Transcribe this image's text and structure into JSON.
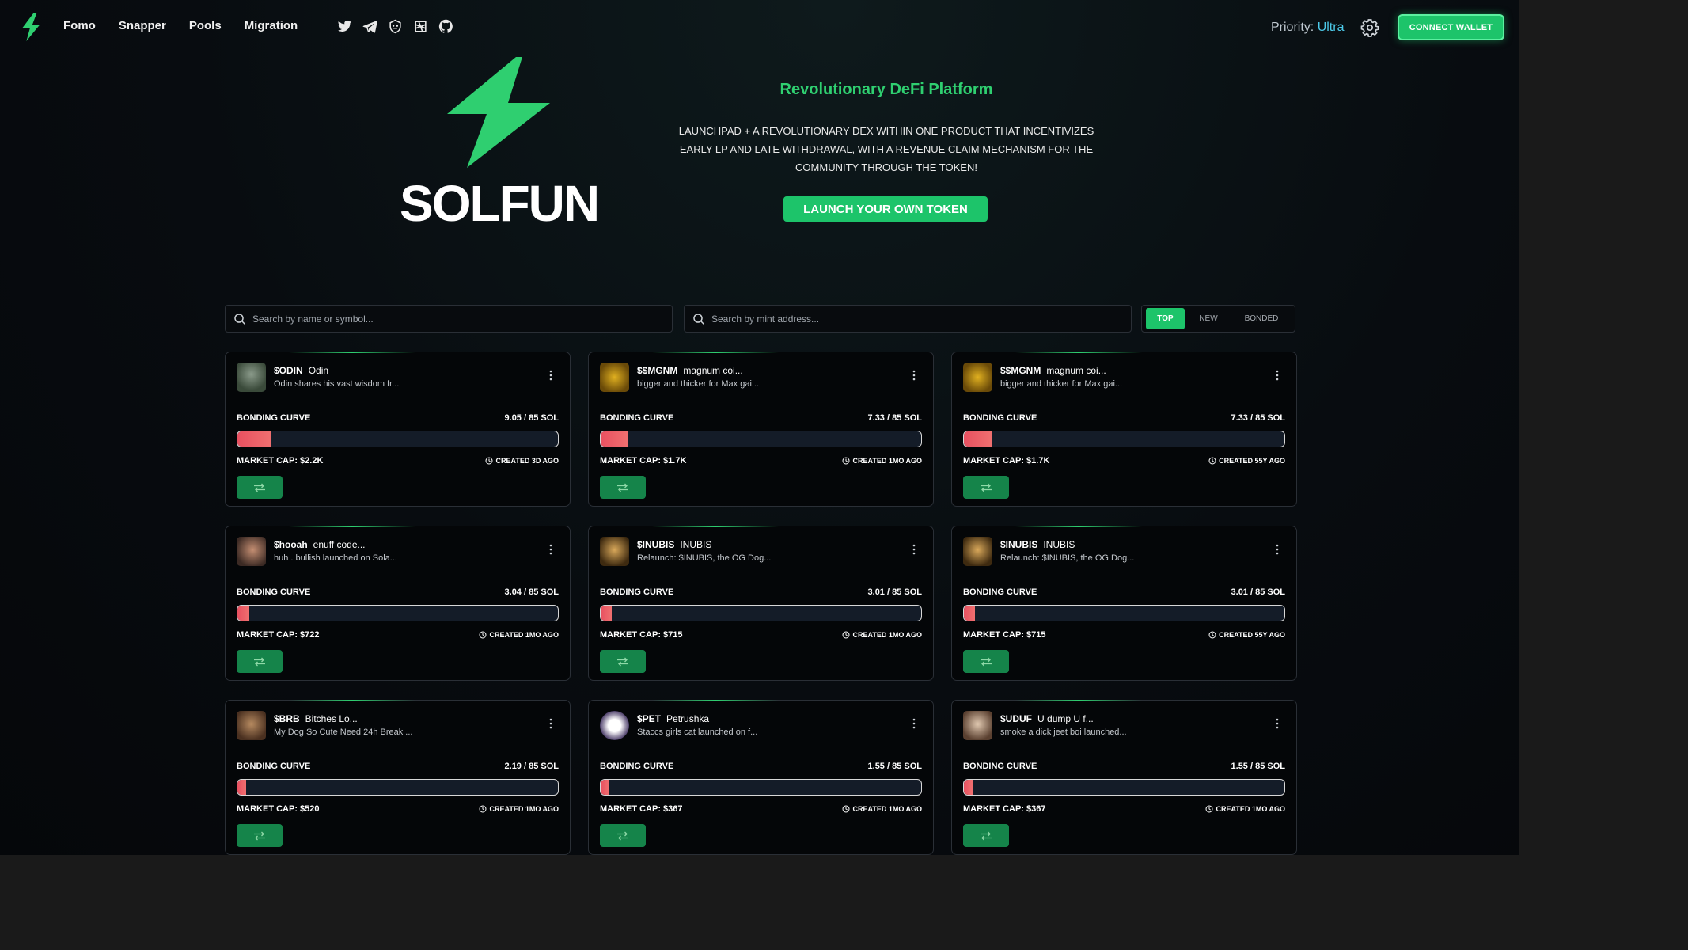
{
  "nav": {
    "links": [
      "Fomo",
      "Snapper",
      "Pools",
      "Migration"
    ],
    "socials": [
      "twitter-icon",
      "telegram-icon",
      "gitbook-icon",
      "dexscreener-icon",
      "github-icon"
    ],
    "priority_label": "Priority:",
    "priority_value": "Ultra",
    "connect_label": "CONNECT WALLET"
  },
  "hero": {
    "brand": "SOLFUN",
    "tagline": "Revolutionary DeFi Platform",
    "description": "LAUNCHPAD + A REVOLUTIONARY DEX WITHIN ONE PRODUCT THAT INCENTIVIZES EARLY LP AND LATE WITHDRAWAL, WITH A REVENUE CLAIM MECHANISM FOR THE COMMUNITY THROUGH THE TOKEN!",
    "launch_label": "LAUNCH YOUR OWN TOKEN"
  },
  "search": {
    "name_placeholder": "Search by name or symbol...",
    "mint_placeholder": "Search by mint address..."
  },
  "tabs": [
    {
      "label": "TOP",
      "active": true
    },
    {
      "label": "NEW",
      "active": false
    },
    {
      "label": "BONDED",
      "active": false
    }
  ],
  "bonding_label": "BONDING CURVE",
  "colors": {
    "accent": "#1dc46a",
    "progress": "#e85060",
    "background": "#05070a"
  },
  "tokens": [
    {
      "symbol": "$ODIN",
      "name": "Odin",
      "description": "Odin shares his vast wisdom fr...",
      "bonding": "9.05 / 85 SOL",
      "progress": 0.106,
      "market_cap": "MARKET CAP: $2.2K",
      "created": "CREATED 3D AGO"
    },
    {
      "symbol": "$$MGNM",
      "name": "magnum coi...",
      "description": "bigger and thicker for Max gai...",
      "bonding": "7.33 / 85 SOL",
      "progress": 0.086,
      "market_cap": "MARKET CAP: $1.7K",
      "created": "CREATED 1MO AGO"
    },
    {
      "symbol": "$$MGNM",
      "name": "magnum coi...",
      "description": "bigger and thicker for Max gai...",
      "bonding": "7.33 / 85 SOL",
      "progress": 0.086,
      "market_cap": "MARKET CAP: $1.7K",
      "created": "CREATED 55Y AGO"
    },
    {
      "symbol": "$hooah",
      "name": "enuff code...",
      "description": "huh . bullish launched on Sola...",
      "bonding": "3.04 / 85 SOL",
      "progress": 0.036,
      "market_cap": "MARKET CAP: $722",
      "created": "CREATED 1MO AGO"
    },
    {
      "symbol": "$INUBIS",
      "name": "INUBIS",
      "description": "Relaunch: $INUBIS, the OG Dog...",
      "bonding": "3.01 / 85 SOL",
      "progress": 0.035,
      "market_cap": "MARKET CAP: $715",
      "created": "CREATED 1MO AGO"
    },
    {
      "symbol": "$INUBIS",
      "name": "INUBIS",
      "description": "Relaunch: $INUBIS, the OG Dog...",
      "bonding": "3.01 / 85 SOL",
      "progress": 0.035,
      "market_cap": "MARKET CAP: $715",
      "created": "CREATED 55Y AGO"
    },
    {
      "symbol": "$BRB",
      "name": "Bitches Lo...",
      "description": "My Dog So Cute Need 24h Break ...",
      "bonding": "2.19 / 85 SOL",
      "progress": 0.026,
      "market_cap": "MARKET CAP: $520",
      "created": "CREATED 1MO AGO"
    },
    {
      "symbol": "$PET",
      "name": "Petrushka",
      "description": "Staccs girls cat launched on f...",
      "bonding": "1.55 / 85 SOL",
      "progress": 0.018,
      "market_cap": "MARKET CAP: $367",
      "created": "CREATED 1MO AGO"
    },
    {
      "symbol": "$UDUF",
      "name": "U dump U f...",
      "description": "smoke a dick jeet boi launched...",
      "bonding": "1.55 / 85 SOL",
      "progress": 0.018,
      "market_cap": "MARKET CAP: $367",
      "created": "CREATED 1MO AGO"
    }
  ]
}
